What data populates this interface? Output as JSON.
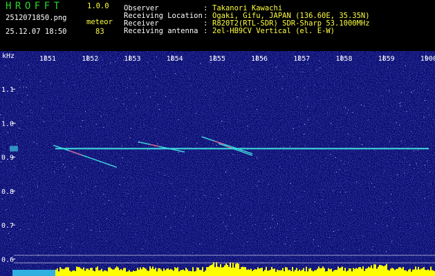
{
  "app": {
    "name": "HROFFT",
    "version": "1.0.0"
  },
  "file": {
    "name": "2512071850.png",
    "datetime": "25.12.07 18:50",
    "mode_label": "meteor",
    "count": "83"
  },
  "info": {
    "rows": [
      {
        "label": "Observer",
        "value": "Takanori Kawachi"
      },
      {
        "label": "Receiving Location",
        "value": "Ogaki, Gifu, JAPAN (136.60E, 35.35N)"
      },
      {
        "label": "Receiver",
        "value": "R820T2(RTL-SDR) SDR-Sharp 53.1000MHz"
      },
      {
        "label": "Receiving antenna",
        "value": "2el-HB9CV Vertical (el. E-W)"
      }
    ]
  },
  "colors": {
    "background": "#000000",
    "label_yellow": "#ffff40",
    "logo_green": "#28d828",
    "field": "#0a0a6e",
    "echo_cyan": "#40e0e0",
    "bar": "#ffff00"
  },
  "chart_data": {
    "type": "heatmap",
    "ylabel": "kHz",
    "x_ticks": [
      "1851",
      "1852",
      "1853",
      "1854",
      "1855",
      "1856",
      "1857",
      "1858",
      "1859",
      "1900"
    ],
    "y_ticks": [
      "1.1",
      "1.0",
      "0.9",
      "0.8",
      "0.7",
      "0.6"
    ],
    "ylim": [
      0.55,
      1.2
    ],
    "carrier_khz": 0.925,
    "echoes": [
      {
        "t_start": "1851.2",
        "t_end": "1852.7",
        "f_start": 0.935,
        "f_end": 0.87
      },
      {
        "t_start": "1853.2",
        "t_end": "1854.3",
        "f_start": 0.945,
        "f_end": 0.915
      },
      {
        "t_start": "1854.7",
        "t_end": "1855.9",
        "f_start": 0.96,
        "f_end": 0.91
      },
      {
        "t_start": "1855.1",
        "t_end": "1855.9",
        "f_start": 0.94,
        "f_end": 0.905
      }
    ]
  }
}
